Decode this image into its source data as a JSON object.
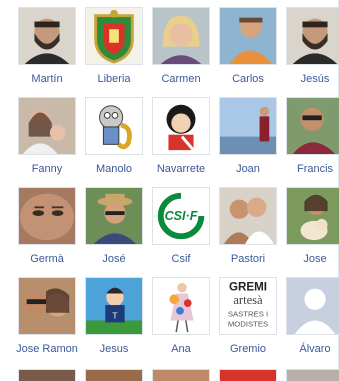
{
  "friends": [
    {
      "name": "Martín",
      "icon": "photo-person-beard"
    },
    {
      "name": "Liberia",
      "icon": "coat-of-arms"
    },
    {
      "name": "Carmen",
      "icon": "photo-person-blonde"
    },
    {
      "name": "Carlos",
      "icon": "photo-person-orange-shirt"
    },
    {
      "name": "Jesús",
      "icon": "photo-person-beard"
    },
    {
      "name": "Fanny",
      "icon": "photo-person-child"
    },
    {
      "name": "Manolo",
      "icon": "cartoon-saxophone"
    },
    {
      "name": "Navarrete",
      "icon": "cartoon-mafalda"
    },
    {
      "name": "Joan",
      "icon": "photo-person-standing"
    },
    {
      "name": "Francis",
      "icon": "photo-person-sunglasses"
    },
    {
      "name": "Germà",
      "icon": "photo-face-closeup"
    },
    {
      "name": "José",
      "icon": "photo-person-hat"
    },
    {
      "name": "Csif",
      "icon": "csif-logo"
    },
    {
      "name": "Pastori",
      "icon": "photo-couple"
    },
    {
      "name": "Jose",
      "icon": "photo-person-dog"
    },
    {
      "name": "Jose Ramon",
      "icon": "photo-couple-sunglasses"
    },
    {
      "name": "Jesus",
      "icon": "cartoon-footballer"
    },
    {
      "name": "Ana",
      "icon": "fashion-sketch"
    },
    {
      "name": "Gremio",
      "icon": "gremi-logo"
    },
    {
      "name": "Álvaro",
      "icon": "default-avatar"
    }
  ],
  "logos": {
    "csif": "CSI·F",
    "gremi": [
      "GREMI",
      "artesà",
      "SASTRES I",
      "MODISTES"
    ]
  }
}
